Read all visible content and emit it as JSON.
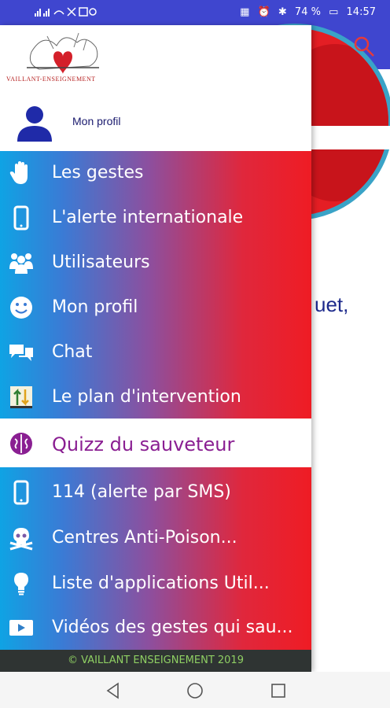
{
  "status_bar": {
    "left_icons": [
      "signal-icon",
      "wifi-icon",
      "mute-icon",
      "image-icon",
      "data-icon"
    ],
    "left_text": "•••",
    "battery": "74 %",
    "time": "14:57"
  },
  "background_app": {
    "partial_text": "uet,"
  },
  "drawer": {
    "logo_text": "VAILLANT-ENSEIGNEMENT",
    "profile_label": "Mon profil",
    "menu_items": [
      {
        "label": "Les gestes",
        "icon": "hand-icon"
      },
      {
        "label": "L'alerte internationale",
        "icon": "phone-icon"
      },
      {
        "label": "Utilisateurs",
        "icon": "users-icon"
      },
      {
        "label": "Mon profil",
        "icon": "smiley-icon"
      },
      {
        "label": "Chat",
        "icon": "chat-icon"
      },
      {
        "label": "Le plan d'intervention",
        "icon": "plan-icon"
      }
    ],
    "selected_item": {
      "label": "Quizz du sauveteur",
      "icon": "brain-icon"
    },
    "menu_items_b": [
      {
        "label": "114  (alerte  par SMS)",
        "icon": "phone-icon"
      },
      {
        "label": "Centres  Anti-Poison...",
        "icon": "skull-icon"
      },
      {
        "label": "Liste d'applications Util...",
        "icon": "lightbulb-icon"
      },
      {
        "label": "Vidéos des gestes qui sau...",
        "icon": "video-icon"
      }
    ],
    "footer": "© VAILLANT ENSEIGNEMENT 2019"
  },
  "colors": {
    "accent_blue": "#3f46cf",
    "gradient_start": "#0fa3e4",
    "gradient_end": "#ef1c24",
    "selected_text": "#8a1f92",
    "footer_bg": "#2f3433",
    "footer_text": "#8fcf63"
  }
}
